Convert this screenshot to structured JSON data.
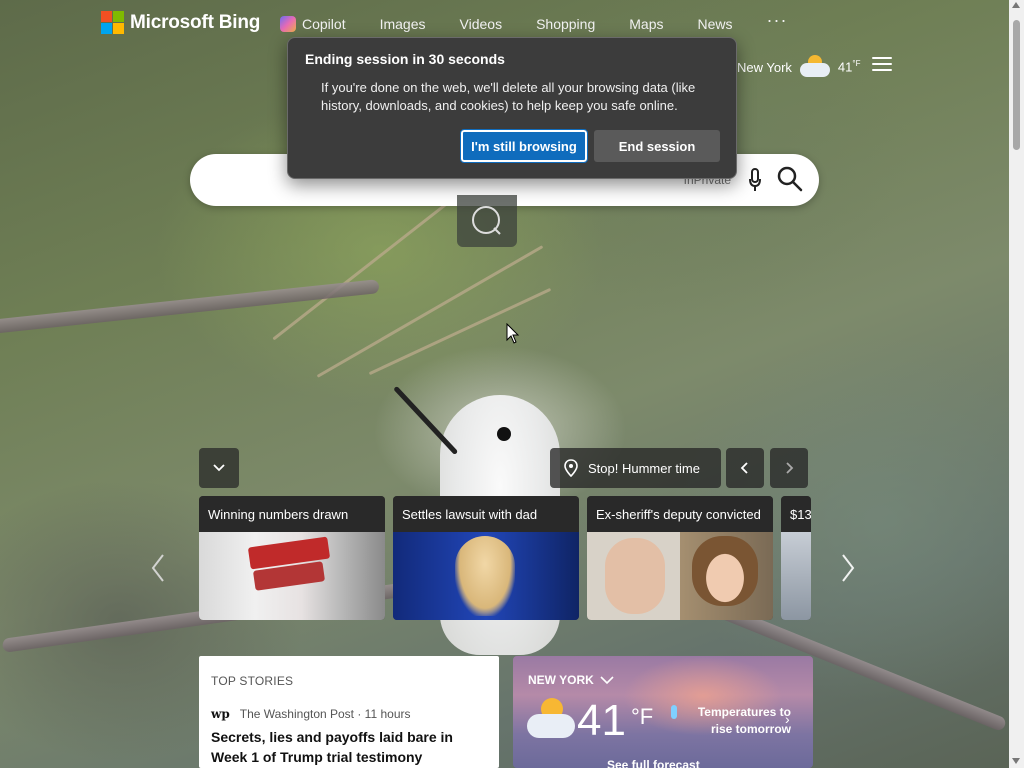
{
  "brand": {
    "logo_text": "Microsoft Bing",
    "logo_colors": [
      "#f25022",
      "#7fba00",
      "#00a4ef",
      "#ffb900"
    ]
  },
  "nav": {
    "items": [
      {
        "label": "Copilot",
        "icon": "copilot-icon"
      },
      {
        "label": "Images"
      },
      {
        "label": "Videos"
      },
      {
        "label": "Shopping"
      },
      {
        "label": "Maps"
      },
      {
        "label": "News"
      }
    ],
    "more": "···"
  },
  "header_weather": {
    "location": "New York",
    "temp": "41",
    "unit": "°F",
    "icon": "partly-cloudy-icon"
  },
  "search": {
    "badge": "InPrivate",
    "mic_icon": "microphone-icon",
    "search_icon": "search-icon"
  },
  "dialog": {
    "title": "Ending session in 30 seconds",
    "body": "If you're done on the web, we'll delete all your browsing data (like history, downloads, and cookies) to help keep you safe online.",
    "primary_button": "I'm still browsing",
    "secondary_button": "End session",
    "accent": "#0f6cbd"
  },
  "image_info": {
    "title": "Stop! Hummer time",
    "icon": "location-pin-icon"
  },
  "news_cards": [
    {
      "title": "Winning numbers drawn"
    },
    {
      "title": "Settles lawsuit with dad"
    },
    {
      "title": "Ex-sheriff's deputy convicted"
    },
    {
      "title": "$13"
    }
  ],
  "top_stories": {
    "heading": "TOP STORIES",
    "source_logo": "wp",
    "source": "The Washington Post · 11 hours",
    "headline": "Secrets, lies and payoffs laid bare in Week 1 of Trump trial testimony"
  },
  "weather_card": {
    "city": "NEW YORK",
    "temp": "41",
    "unit": "°F",
    "note": "Temperatures to rise tomorrow",
    "forecast_link": "See full forecast",
    "icon": "partly-cloudy-icon"
  }
}
